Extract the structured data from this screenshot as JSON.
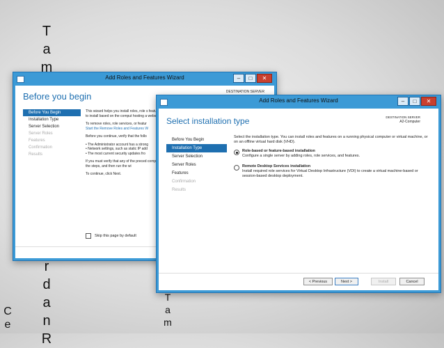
{
  "slide": {
    "vertical_text_main": "TambahkanFiturdanR",
    "vertical_text_left": "Ce",
    "vertical_text_right": "Tam"
  },
  "back_window": {
    "title": "Add Roles and Features Wizard",
    "page_title": "Before you begin",
    "destination_label": "DESTINATION SERVER",
    "nav": [
      {
        "label": "Before You Begin",
        "state": "selected"
      },
      {
        "label": "Installation Type",
        "state": "normal"
      },
      {
        "label": "Server Selection",
        "state": "normal"
      },
      {
        "label": "Server Roles",
        "state": "disabled"
      },
      {
        "label": "Features",
        "state": "disabled"
      },
      {
        "label": "Confirmation",
        "state": "disabled"
      },
      {
        "label": "Results",
        "state": "disabled"
      }
    ],
    "body": {
      "p1": "This wizard helps you install roles, role s features to install based on the comput hosting a website.",
      "p2": "To remove roles, role services, or featur",
      "p2_link": "Start the Remove Roles and Features W",
      "p3": "Before you continue, verify that the follo",
      "bullet1": "• The Administrator account has a strong",
      "bullet2": "• Network settings, such as static IP add",
      "bullet3": "• The most current security updates fro",
      "p4": "If you must verify that any of the preced complete the steps, and then run the wi",
      "p5": "To continue, click Next."
    },
    "skip_label": "Skip this page by default"
  },
  "front_window": {
    "title": "Add Roles and Features Wizard",
    "page_title": "Select installation type",
    "destination_label": "DESTINATION SERVER",
    "destination_value": "A2-Computer",
    "nav": [
      {
        "label": "Before You Begin",
        "state": "normal"
      },
      {
        "label": "Installation Type",
        "state": "selected"
      },
      {
        "label": "Server Selection",
        "state": "normal"
      },
      {
        "label": "Server Roles",
        "state": "normal"
      },
      {
        "label": "Features",
        "state": "normal"
      },
      {
        "label": "Confirmation",
        "state": "disabled"
      },
      {
        "label": "Results",
        "state": "disabled"
      }
    ],
    "intro": "Select the installation type. You can install roles and features on a running physical computer or virtual machine, or on an offline virtual hard disk (VHD).",
    "options": [
      {
        "label": "Role-based or feature-based installation",
        "desc": "Configure a single server by adding roles, role services, and features.",
        "selected": true
      },
      {
        "label": "Remote Desktop Services installation",
        "desc": "Install required role services for Virtual Desktop Infrastructure (VDI) to create a virtual machine-based or session-based desktop deployment.",
        "selected": false
      }
    ],
    "buttons": {
      "previous": "< Previous",
      "next": "Next >",
      "install": "Install",
      "cancel": "Cancel"
    }
  },
  "colors": {
    "accent": "#1e6fb0",
    "titlebar": "#3c9ad6",
    "close": "#c9402f"
  }
}
